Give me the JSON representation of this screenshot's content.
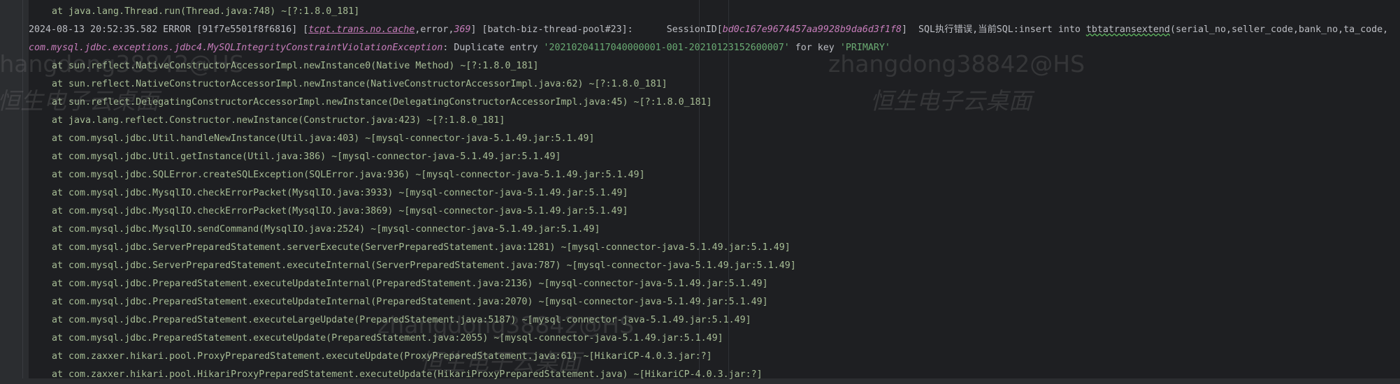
{
  "watermark": {
    "user": "zhangdong38842@HS",
    "label": "恒生电子云桌面"
  },
  "lines": [
    {
      "type": "stack",
      "text": "at java.lang.Thread.run(Thread.java:748) ~[?:1.8.0_181]"
    },
    {
      "type": "log",
      "timestamp": "2024-08-13 20:52:35.582 ERROR ",
      "trace_id": "[91f7e5501f8f6816] ",
      "logger_open": "[",
      "logger": "tcpt.trans.no.cache",
      "logger_sep1": ",error,",
      "logger_line": "369",
      "logger_close": "] ",
      "thread": "[batch-biz-thread-pool#23]:",
      "session_label": "      SessionID[",
      "session_id": "bd0c167e9674457aa9928b9da6d3f1f8",
      "session_close": "]  SQL执行错误,当前SQL:insert into ",
      "table": "tbtatransextend",
      "columns": "(serial_no,seller_code,bank_no,ta_code,"
    },
    {
      "type": "exception",
      "exception": "com.mysql.jdbc.exceptions.jdbc4.MySQLIntegrityConstraintViolationException",
      "message": ": Duplicate entry ",
      "entry": "'20210204117040000001-001-20210123152600007'",
      "key_text": " for key ",
      "key": "'PRIMARY'"
    },
    {
      "type": "stack",
      "text": "at sun.reflect.NativeConstructorAccessorImpl.newInstance0(Native Method) ~[?:1.8.0_181]"
    },
    {
      "type": "stack",
      "text": "at sun.reflect.NativeConstructorAccessorImpl.newInstance(NativeConstructorAccessorImpl.java:62) ~[?:1.8.0_181]"
    },
    {
      "type": "stack",
      "text": "at sun.reflect.DelegatingConstructorAccessorImpl.newInstance(DelegatingConstructorAccessorImpl.java:45) ~[?:1.8.0_181]"
    },
    {
      "type": "stack",
      "text": "at java.lang.reflect.Constructor.newInstance(Constructor.java:423) ~[?:1.8.0_181]"
    },
    {
      "type": "stack",
      "text": "at com.mysql.jdbc.Util.handleNewInstance(Util.java:403) ~[mysql-connector-java-5.1.49.jar:5.1.49]"
    },
    {
      "type": "stack",
      "text": "at com.mysql.jdbc.Util.getInstance(Util.java:386) ~[mysql-connector-java-5.1.49.jar:5.1.49]"
    },
    {
      "type": "stack",
      "text": "at com.mysql.jdbc.SQLError.createSQLException(SQLError.java:936) ~[mysql-connector-java-5.1.49.jar:5.1.49]"
    },
    {
      "type": "stack",
      "text": "at com.mysql.jdbc.MysqlIO.checkErrorPacket(MysqlIO.java:3933) ~[mysql-connector-java-5.1.49.jar:5.1.49]"
    },
    {
      "type": "stack",
      "text": "at com.mysql.jdbc.MysqlIO.checkErrorPacket(MysqlIO.java:3869) ~[mysql-connector-java-5.1.49.jar:5.1.49]"
    },
    {
      "type": "stack",
      "text": "at com.mysql.jdbc.MysqlIO.sendCommand(MysqlIO.java:2524) ~[mysql-connector-java-5.1.49.jar:5.1.49]"
    },
    {
      "type": "stack",
      "text": "at com.mysql.jdbc.ServerPreparedStatement.serverExecute(ServerPreparedStatement.java:1281) ~[mysql-connector-java-5.1.49.jar:5.1.49]"
    },
    {
      "type": "stack",
      "text": "at com.mysql.jdbc.ServerPreparedStatement.executeInternal(ServerPreparedStatement.java:787) ~[mysql-connector-java-5.1.49.jar:5.1.49]"
    },
    {
      "type": "stack",
      "text": "at com.mysql.jdbc.PreparedStatement.executeUpdateInternal(PreparedStatement.java:2136) ~[mysql-connector-java-5.1.49.jar:5.1.49]"
    },
    {
      "type": "stack",
      "text": "at com.mysql.jdbc.PreparedStatement.executeUpdateInternal(PreparedStatement.java:2070) ~[mysql-connector-java-5.1.49.jar:5.1.49]"
    },
    {
      "type": "stack",
      "text": "at com.mysql.jdbc.PreparedStatement.executeLargeUpdate(PreparedStatement.java:5187) ~[mysql-connector-java-5.1.49.jar:5.1.49]"
    },
    {
      "type": "stack",
      "text": "at com.mysql.jdbc.PreparedStatement.executeUpdate(PreparedStatement.java:2055) ~[mysql-connector-java-5.1.49.jar:5.1.49]"
    },
    {
      "type": "stack",
      "text": "at com.zaxxer.hikari.pool.ProxyPreparedStatement.executeUpdate(ProxyPreparedStatement.java:61) ~[HikariCP-4.0.3.jar:?]"
    },
    {
      "type": "stack",
      "text": "at com.zaxxer.hikari.pool.HikariProxyPreparedStatement.executeUpdate(HikariProxyPreparedStatement.java) ~[HikariCP-4.0.3.jar:?]"
    }
  ]
}
